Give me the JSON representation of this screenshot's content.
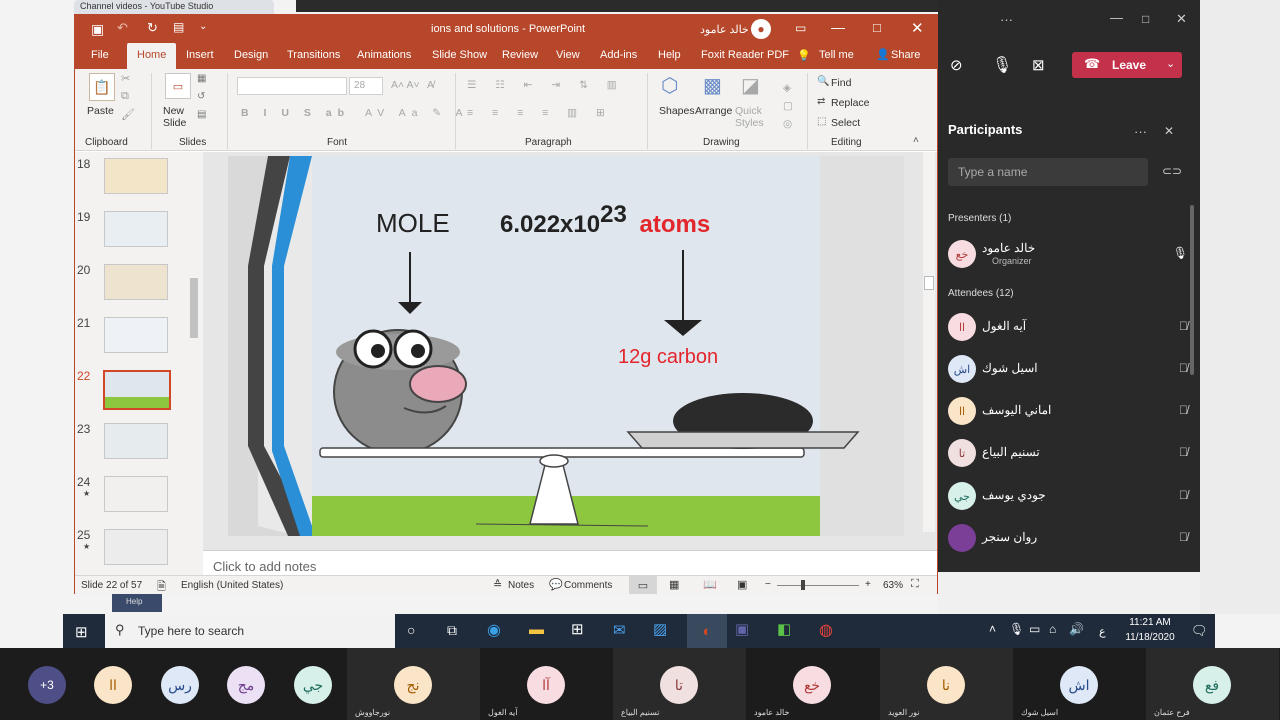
{
  "browser_tab": {
    "title": "Channel videos - YouTube Studio"
  },
  "ppt": {
    "title": "ions and solutions - PowerPoint",
    "user": "خالد عامود",
    "tabs": [
      "File",
      "Home",
      "Insert",
      "Design",
      "Transitions",
      "Animations",
      "Slide Show",
      "Review",
      "View",
      "Add-ins",
      "Help",
      "Foxit Reader PDF",
      "Tell me",
      "Share"
    ],
    "ribbon": {
      "paste": "Paste",
      "new_slide": "New Slide",
      "font_size": "28",
      "shapes": "Shapes",
      "arrange": "Arrange",
      "quick_styles": "Quick Styles",
      "find": "Find",
      "replace": "Replace",
      "select": "Select",
      "groups": {
        "clipboard": "Clipboard",
        "slides": "Slides",
        "font": "Font",
        "paragraph": "Paragraph",
        "drawing": "Drawing",
        "editing": "Editing"
      }
    },
    "thumbnails": [
      {
        "num": "18",
        "selected": false,
        "star": false
      },
      {
        "num": "19",
        "selected": false,
        "star": false
      },
      {
        "num": "20",
        "selected": false,
        "star": false
      },
      {
        "num": "21",
        "selected": false,
        "star": false
      },
      {
        "num": "22",
        "selected": true,
        "star": false
      },
      {
        "num": "23",
        "selected": false,
        "star": false
      },
      {
        "num": "24",
        "selected": false,
        "star": true
      },
      {
        "num": "25",
        "selected": false,
        "star": true
      }
    ],
    "slide": {
      "mole": "MOLE",
      "number": "6.022x10",
      "exponent": "23",
      "atoms": "atoms",
      "carbon": "12g carbon"
    },
    "notes_placeholder": "Click to add notes",
    "status": {
      "slide": "Slide 22 of 57",
      "language": "English (United States)",
      "notes": "Notes",
      "comments": "Comments",
      "zoom": "63%"
    }
  },
  "teams": {
    "leave": "Leave",
    "participants_title": "Participants",
    "search_placeholder": "Type a name",
    "presenters_header": "Presenters (1)",
    "presenter": {
      "initials": "خع",
      "name": "خالد عامود",
      "role": "Organizer"
    },
    "attendees_header": "Attendees (12)",
    "attendees": [
      {
        "initials": "اا",
        "name": "آيه الغول"
      },
      {
        "initials": "اش",
        "name": "اسيل شوك"
      },
      {
        "initials": "اا",
        "name": "اماني اليوسف"
      },
      {
        "initials": "تا",
        "name": "تسنيم البياع"
      },
      {
        "initials": "جي",
        "name": "جودي يوسف"
      },
      {
        "initials": "",
        "name": "روان سنجر"
      }
    ],
    "help": "Help"
  },
  "taskbar": {
    "search_placeholder": "Type here to search",
    "time": "11:21 AM",
    "date": "11/18/2020",
    "lang": "ع"
  },
  "bottom_strip": [
    {
      "initials": "+3",
      "label": ""
    },
    {
      "initials": "اا",
      "label": ""
    },
    {
      "initials": "رس",
      "label": ""
    },
    {
      "initials": "مج",
      "label": ""
    },
    {
      "initials": "جي",
      "label": ""
    },
    {
      "initials": "نج",
      "label": "نورجاووش"
    },
    {
      "initials": "آا",
      "label": "آيه الغول"
    },
    {
      "initials": "تا",
      "label": "تسنيم البياع"
    },
    {
      "initials": "خع",
      "label": "خالد عامود"
    },
    {
      "initials": "نا",
      "label": "نور العويد"
    },
    {
      "initials": "اش",
      "label": "اسيل شوك"
    },
    {
      "initials": "فع",
      "label": "فرح عثمان"
    }
  ],
  "colors": {
    "ppt_accent": "#b7472a",
    "teams_dark": "#292929",
    "leave_red": "#c4314b"
  }
}
